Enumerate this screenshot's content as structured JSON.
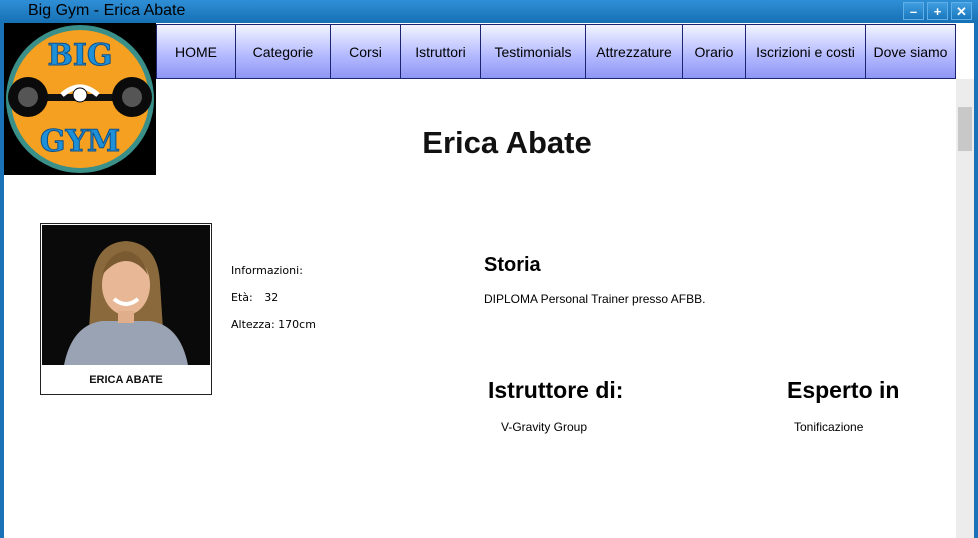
{
  "window": {
    "title": "Big Gym - Erica Abate",
    "minimize": "–",
    "maximize": "+",
    "close": "✕"
  },
  "nav": {
    "items": [
      "HOME",
      "Categorie",
      "Corsi",
      "Istruttori",
      "Testimonials",
      "Attrezzature",
      "Orario",
      "Iscrizioni e costi",
      "Dove siamo"
    ]
  },
  "logo": {
    "top_text": "BIG",
    "bottom_text": "GYM"
  },
  "page": {
    "title": "Erica Abate"
  },
  "photo": {
    "caption": "ERICA ABATE"
  },
  "info": {
    "heading": "Informazioni:",
    "age_label": "Età:",
    "age_value": "32",
    "height_label": "Altezza:",
    "height_value": "170cm"
  },
  "storia": {
    "heading": "Storia",
    "text": "DIPLOMA Personal Trainer presso AFBB."
  },
  "istruttore": {
    "heading": "Istruttore di:",
    "items": [
      "V-Gravity Group"
    ]
  },
  "esperto": {
    "heading": "Esperto in",
    "items": [
      "Tonificazione"
    ]
  }
}
